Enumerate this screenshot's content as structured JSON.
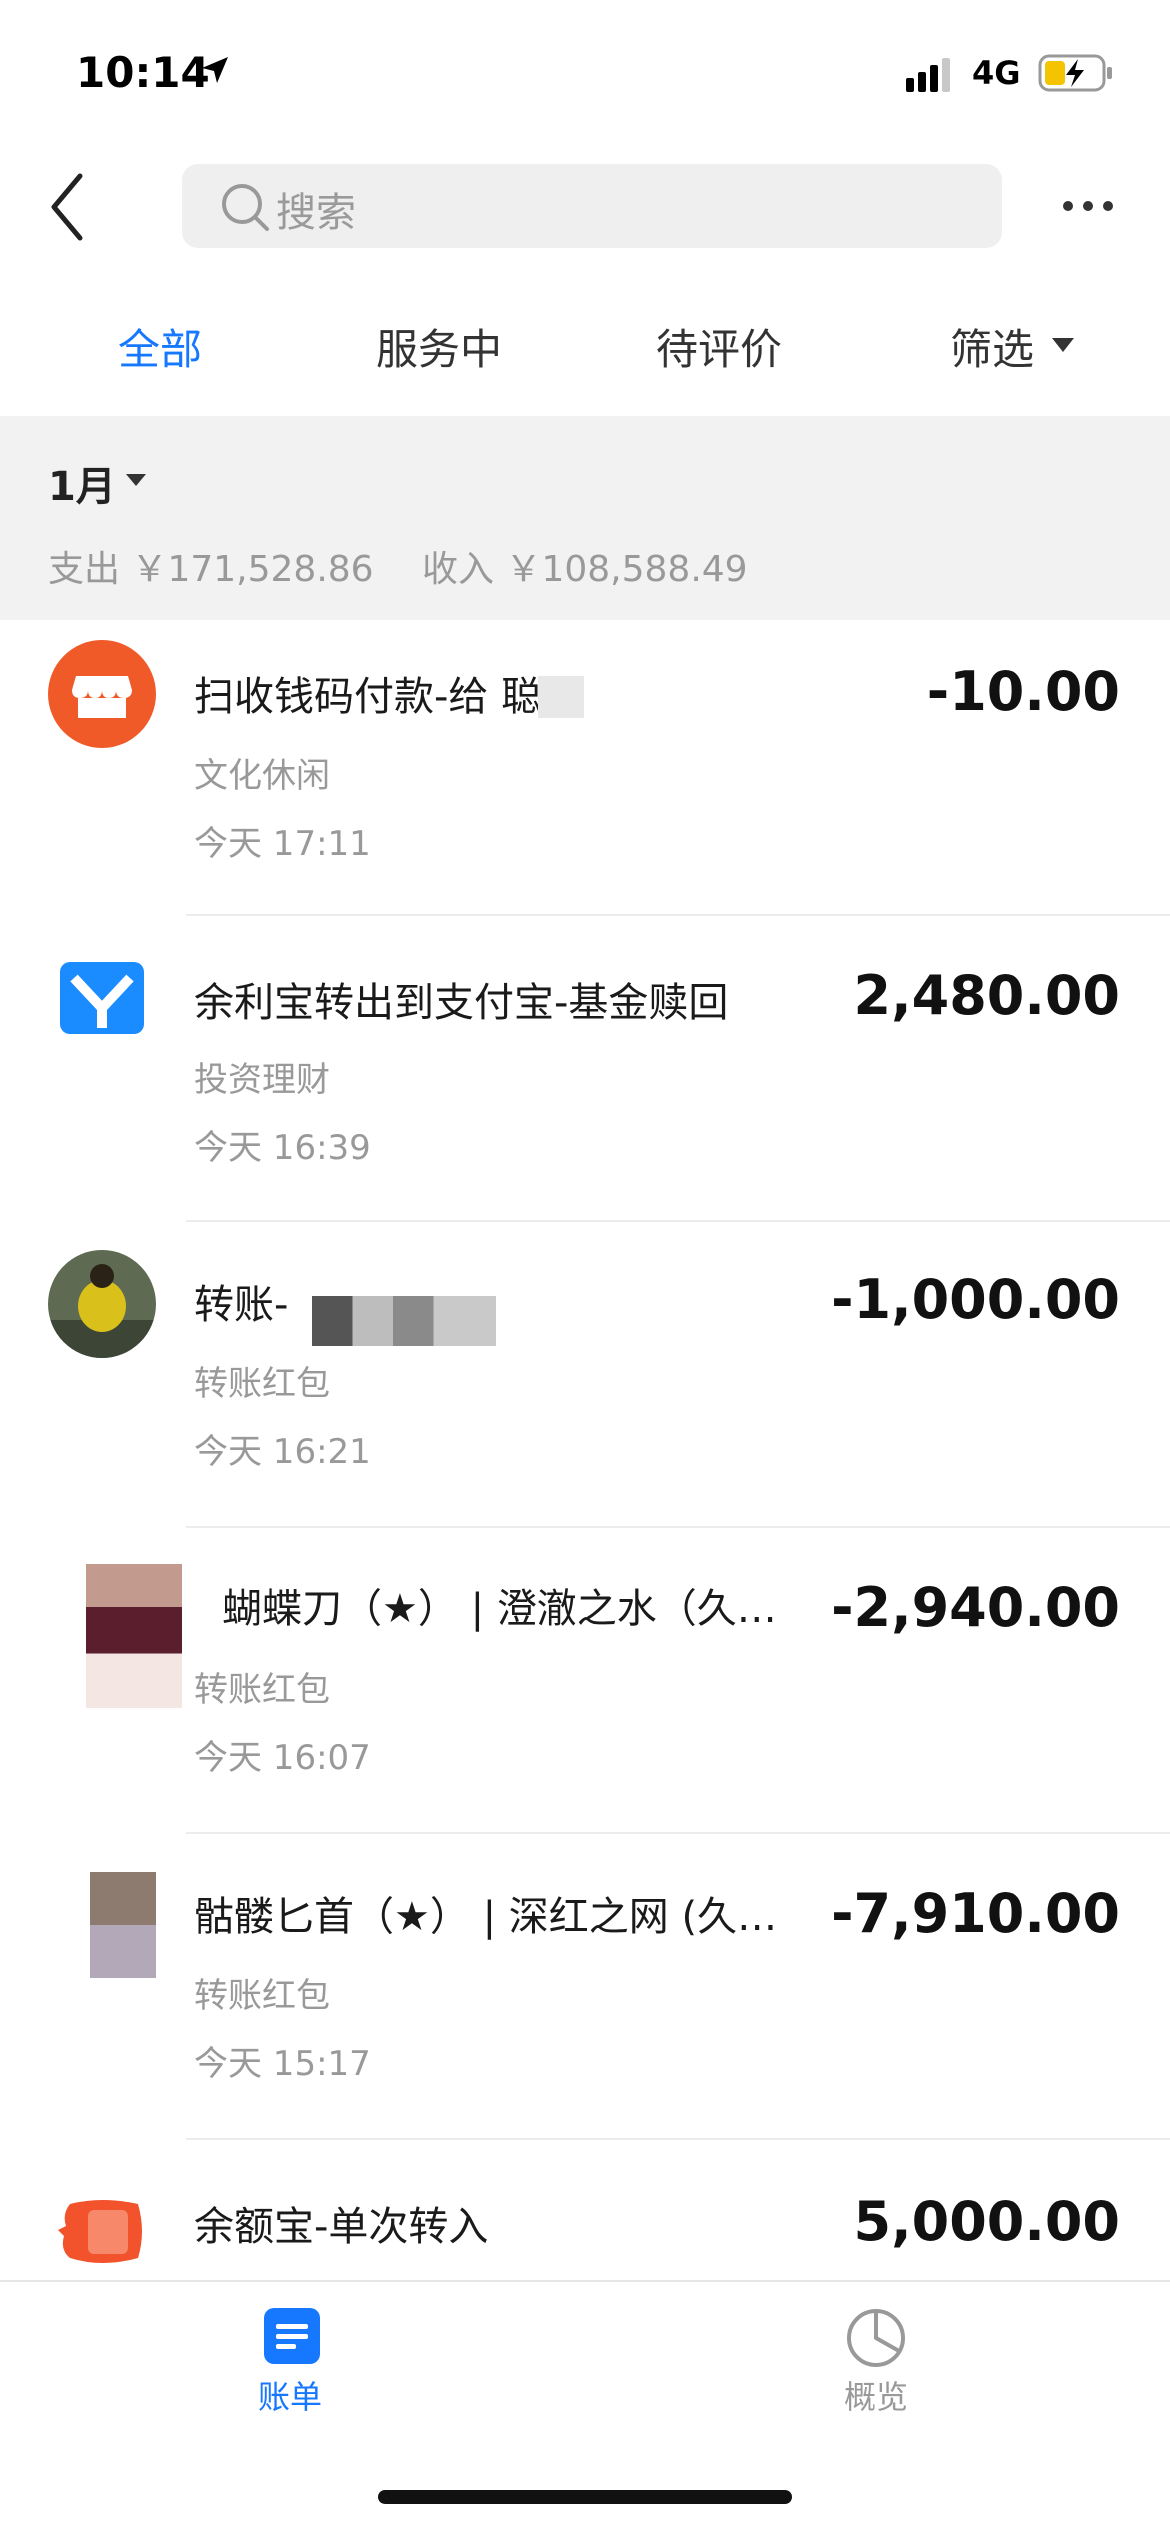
{
  "status_bar": {
    "time": "10:14",
    "network": "4G"
  },
  "search": {
    "placeholder": "搜索"
  },
  "tabs": [
    {
      "label": "全部",
      "active": true
    },
    {
      "label": "服务中",
      "active": false
    },
    {
      "label": "待评价",
      "active": false
    },
    {
      "label": "筛选",
      "active": false
    }
  ],
  "summary": {
    "month": "1月",
    "expense": "支出 ￥171,528.86",
    "income": "收入 ￥108,588.49"
  },
  "transactions": [
    {
      "title": "扫收钱码付款-给 聪",
      "category": "文化休闲",
      "time": "今天  17:11",
      "amount": "-10.00"
    },
    {
      "title": "余利宝转出到支付宝-基金赎回",
      "category": "投资理财",
      "time": "今天  16:39",
      "amount": "2,480.00"
    },
    {
      "title": "转账-",
      "category": "转账红包",
      "time": "今天  16:21",
      "amount": "-1,000.00"
    },
    {
      "title": "蝴蝶刀（★） | 澄澈之水（久…",
      "category": "转账红包",
      "time": "今天  16:07",
      "amount": "-2,940.00"
    },
    {
      "title": "骷髅匕首（★） | 深红之网 (久…",
      "category": "转账红包",
      "time": "今天  15:17",
      "amount": "-7,910.00"
    },
    {
      "title": "余额宝-单次转入",
      "category": "",
      "time": "",
      "amount": "5,000.00"
    }
  ],
  "bottom_nav": [
    {
      "label": "账单",
      "active": true,
      "icon": "bill-icon"
    },
    {
      "label": "概览",
      "active": false,
      "icon": "pie-chart-icon"
    }
  ],
  "colors": {
    "accent": "#1677ff",
    "merchant_orange": "#f05a28",
    "yulibao_blue": "#1a8cff"
  }
}
